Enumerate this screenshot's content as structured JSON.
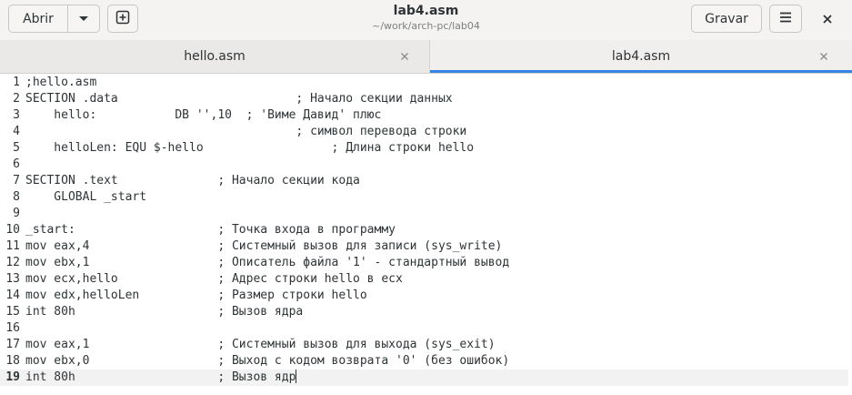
{
  "header": {
    "open_label": "Abrir",
    "save_label": "Gravar",
    "title": "lab4.asm",
    "subtitle": "~/work/arch-pc/lab04"
  },
  "tabs": [
    {
      "label": "hello.asm",
      "active": false
    },
    {
      "label": "lab4.asm",
      "active": true
    }
  ],
  "icons": {
    "open_menu": "chevron-down-icon",
    "new_document": "new-document-icon",
    "main_menu": "hamburger-menu-icon",
    "close_window": "close-icon",
    "close_tab": "close-icon"
  },
  "colors": {
    "accent": "#3584e4",
    "current_line": "#f2f2f2"
  },
  "editor": {
    "current_line": 19,
    "lines": [
      {
        "n": "1",
        "text": ";hello.asm"
      },
      {
        "n": "2",
        "text": "SECTION .data                         ; Начало секции данных"
      },
      {
        "n": "3",
        "text": "    hello:           DB '',10  ; 'Виме Давид' плюс"
      },
      {
        "n": "4",
        "text": "                                      ; символ перевода строки"
      },
      {
        "n": "5",
        "text": "    helloLen: EQU $-hello                  ; Длина строки hello"
      },
      {
        "n": "6",
        "text": ""
      },
      {
        "n": "7",
        "text": "SECTION .text              ; Начало секции кода"
      },
      {
        "n": "8",
        "text": "    GLOBAL _start"
      },
      {
        "n": "9",
        "text": ""
      },
      {
        "n": "10",
        "text": "_start:                    ; Точка входа в программу"
      },
      {
        "n": "11",
        "text": "mov eax,4                  ; Системный вызов для записи (sys_write)"
      },
      {
        "n": "12",
        "text": "mov ebx,1                  ; Описатель файла '1' - стандартный вывод"
      },
      {
        "n": "13",
        "text": "mov ecx,hello              ; Адрес строки hello в ecx"
      },
      {
        "n": "14",
        "text": "mov edx,helloLen           ; Размер строки hello"
      },
      {
        "n": "15",
        "text": "int 80h                    ; Вызов ядра"
      },
      {
        "n": "16",
        "text": ""
      },
      {
        "n": "17",
        "text": "mov eax,1                  ; Системный вызов для выхода (sys_exit)"
      },
      {
        "n": "18",
        "text": "mov ebx,0                  ; Выход с кодом возврата '0' (без ошибок)"
      },
      {
        "n": "19",
        "text": "int 80h                    ; Вызов ядр"
      }
    ]
  }
}
